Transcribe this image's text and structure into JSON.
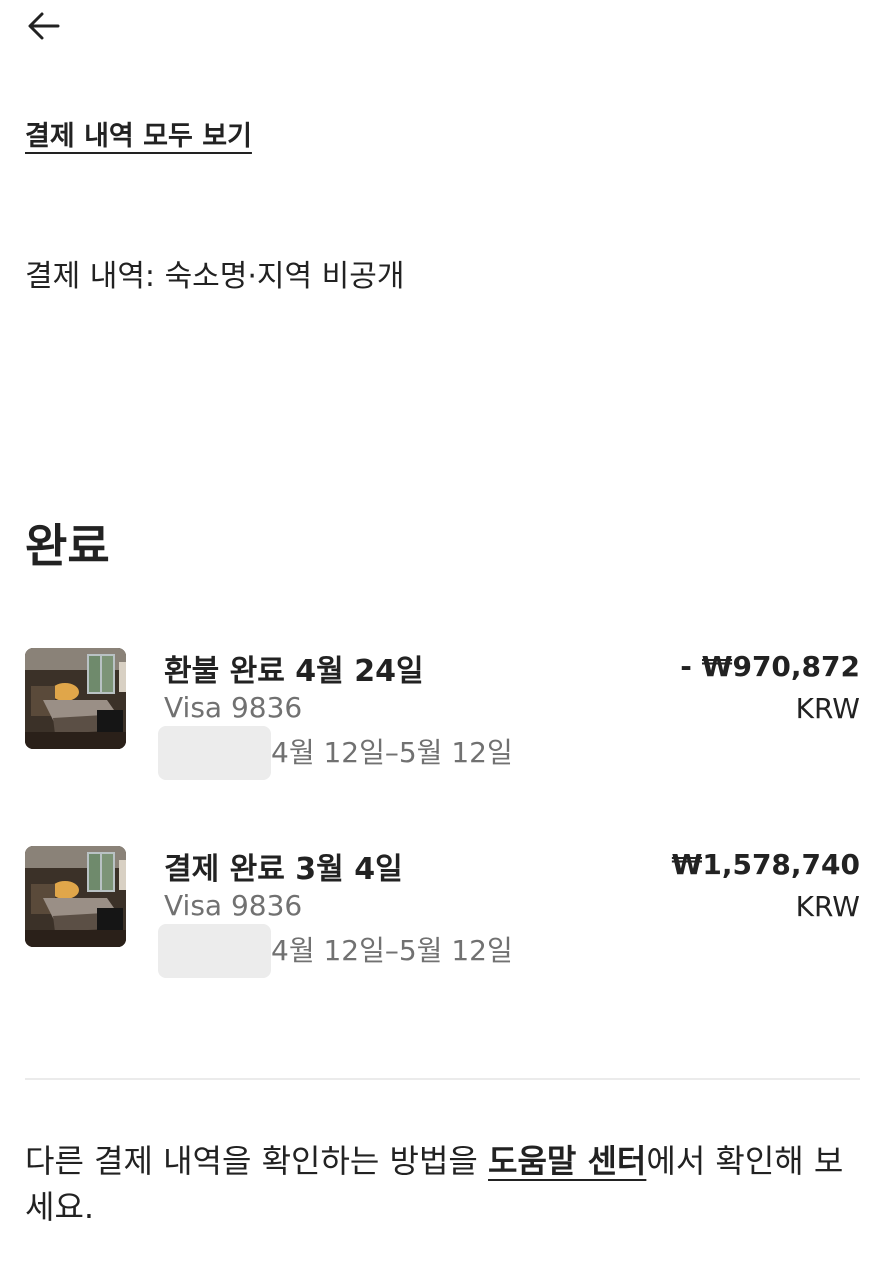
{
  "header": {
    "back_icon": "arrow-left-icon"
  },
  "links": {
    "see_all_history": "결제 내역 모두 보기"
  },
  "history_note": "결제 내역: 숙소명·지역 비공개",
  "section": {
    "title": "완료"
  },
  "transactions": [
    {
      "title": "환불 완료 4월 24일",
      "card": "Visa 9836",
      "dates": "4월 12일–5월 12일",
      "amount": "- ₩970,872",
      "currency": "KRW",
      "thumbnail_icon": "listing-photo"
    },
    {
      "title": "결제 완료 3월 4일",
      "card": "Visa 9836",
      "dates": "4월 12일–5월 12일",
      "amount": "₩1,578,740",
      "currency": "KRW",
      "thumbnail_icon": "listing-photo"
    }
  ],
  "footer": {
    "help_prefix": "다른 결제 내역을 확인하는 방법을 ",
    "help_link": "도움말 센터",
    "help_suffix": "에서 확인해 보세요."
  },
  "colors": {
    "text_primary": "#222222",
    "text_secondary": "#717171",
    "divider": "#ebebeb",
    "redacted": "#ececec"
  }
}
